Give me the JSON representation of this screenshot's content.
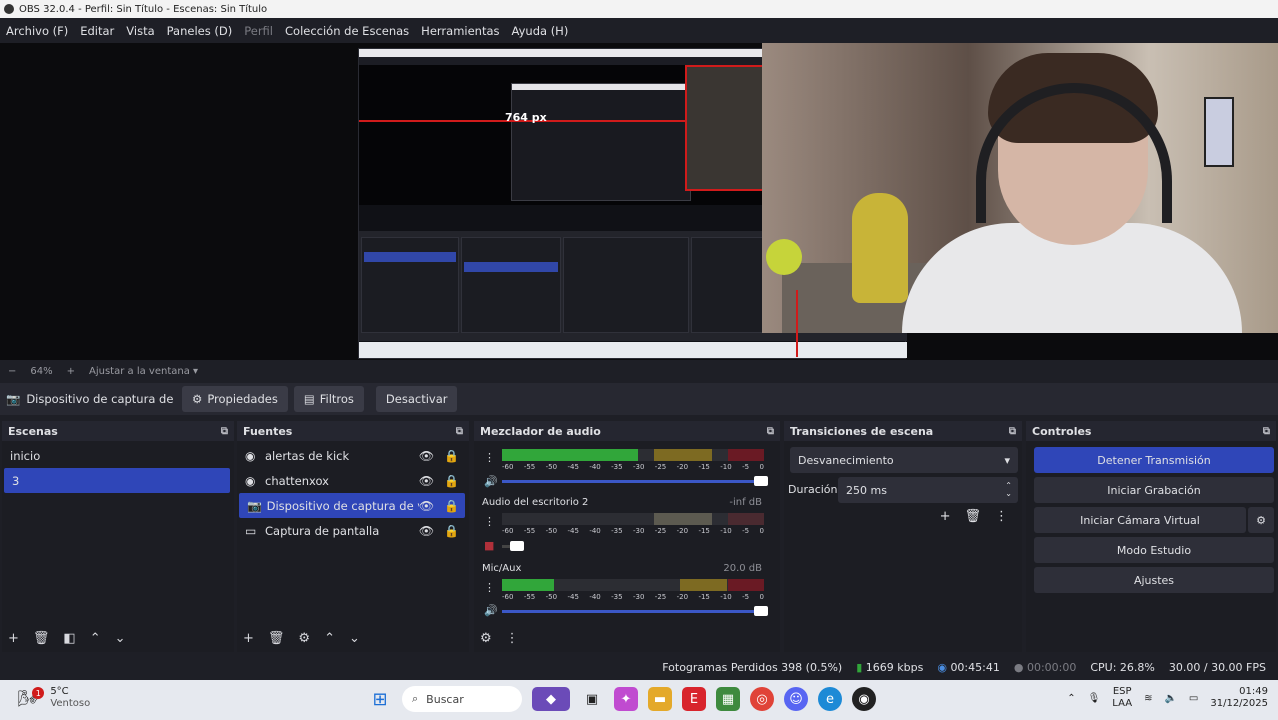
{
  "window": {
    "title": "OBS 32.0.4 - Perfil: Sin Título - Escenas: Sin Título"
  },
  "menu": [
    "Archivo (F)",
    "Editar",
    "Vista",
    "Paneles (D)",
    "Perfil",
    "Colección de Escenas",
    "Herramientas",
    "Ayuda (H)"
  ],
  "preview": {
    "guide_label": "764 px"
  },
  "zoom": {
    "minus": "−",
    "value": "64%",
    "plus": "+",
    "fit_label": "Ajustar a la ventana"
  },
  "toolbar": {
    "source_label": "Dispositivo de captura de v",
    "properties": "Propiedades",
    "filters": "Filtros",
    "deactivate": "Desactivar"
  },
  "scenes": {
    "title": "Escenas",
    "items": [
      "inicio",
      "3"
    ],
    "selected": "3"
  },
  "sources": {
    "title": "Fuentes",
    "items": [
      {
        "name": "alertas de kick",
        "icon": "globe-icon"
      },
      {
        "name": "chattenxox",
        "icon": "globe-icon"
      },
      {
        "name": "Dispositivo de captura de video",
        "icon": "camera-icon"
      },
      {
        "name": "Captura de pantalla",
        "icon": "monitor-icon"
      }
    ]
  },
  "mixer": {
    "title": "Mezclador de audio",
    "channels": [
      {
        "name": "",
        "db": "",
        "level": 0.52
      },
      {
        "name": "Audio del escritorio 2",
        "db": "-inf dB",
        "level": 0.0
      },
      {
        "name": "Mic/Aux",
        "db": "20.0 dB",
        "level": 0.2
      }
    ],
    "ticks": [
      "-60",
      "-55",
      "-50",
      "-45",
      "-40",
      "-35",
      "-30",
      "-25",
      "-20",
      "-15",
      "-10",
      "-5",
      "0"
    ]
  },
  "transitions": {
    "title": "Transiciones de escena",
    "type": "Desvanecimiento",
    "duration_label": "Duración",
    "duration_value": "250 ms"
  },
  "controls": {
    "title": "Controles",
    "stop_stream": "Detener Transmisión",
    "start_record": "Iniciar Grabación",
    "virtual_cam": "Iniciar Cámara Virtual",
    "studio_mode": "Modo Estudio",
    "settings": "Ajustes"
  },
  "status": {
    "dropped_frames": "Fotogramas Perdidos 398 (0.5%)",
    "bitrate": "1669 kbps",
    "stream_time": "00:45:41",
    "record_time": "00:00:00",
    "cpu": "CPU: 26.8%",
    "fps": "30.00 / 30.00 FPS"
  },
  "taskbar": {
    "weather_temp": "5°C",
    "weather_desc": "Ventoso",
    "weather_badge": "1",
    "search": "Buscar",
    "lang_top": "ESP",
    "lang_bottom": "LAA",
    "time": "01:49",
    "date": "31/12/2025"
  },
  "colors": {
    "accent": "#2f46b8",
    "meter_green": "#31a63a",
    "meter_yellow": "#7d6a22",
    "meter_red": "#6a1a24",
    "guide_red": "#d01b1b"
  }
}
